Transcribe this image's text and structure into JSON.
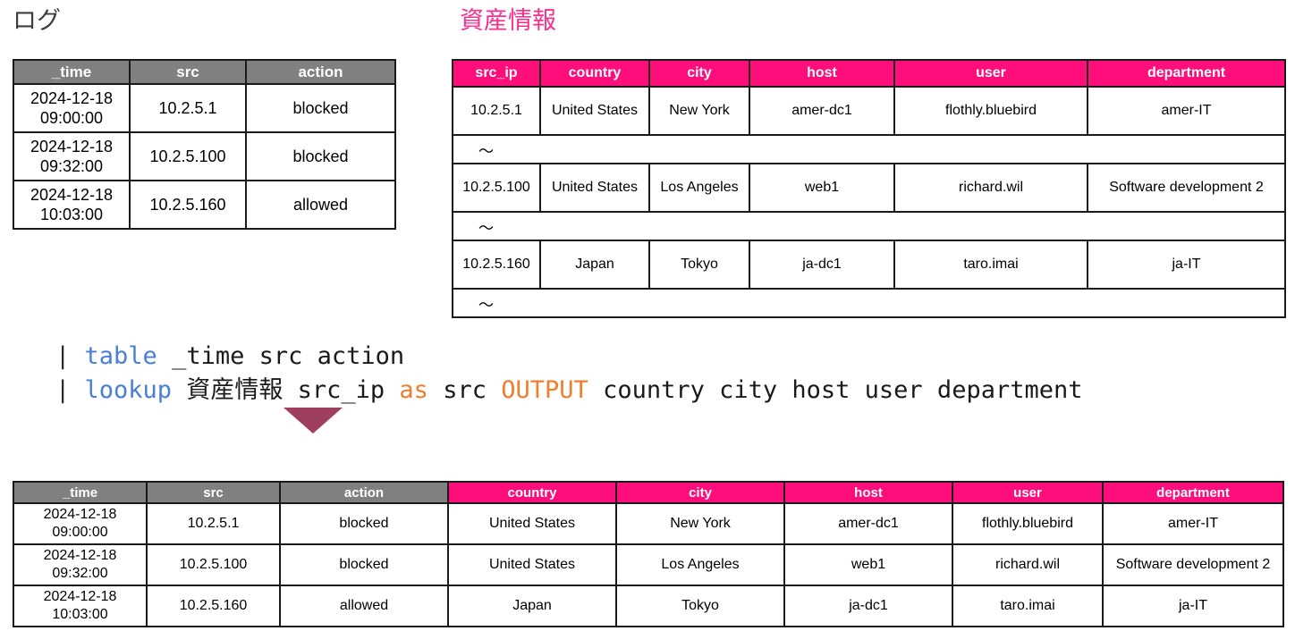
{
  "log_section": {
    "title": "ログ",
    "columns": [
      "_time",
      "src",
      "action"
    ],
    "rows": [
      {
        "time_date": "2024-12-18",
        "time_clock": "09:00:00",
        "src": "10.2.5.1",
        "action": "blocked"
      },
      {
        "time_date": "2024-12-18",
        "time_clock": "09:32:00",
        "src": "10.2.5.100",
        "action": "blocked"
      },
      {
        "time_date": "2024-12-18",
        "time_clock": "10:03:00",
        "src": "10.2.5.160",
        "action": "allowed"
      }
    ]
  },
  "asset_section": {
    "title": "資産情報",
    "columns": [
      "src_ip",
      "country",
      "city",
      "host",
      "user",
      "department"
    ],
    "ellipsis_symbol": "～",
    "rows": [
      {
        "src_ip": "10.2.5.1",
        "country": "United States",
        "city": "New York",
        "host": "amer-dc1",
        "user": "flothly.bluebird",
        "department": "amer-IT"
      },
      {
        "src_ip": "10.2.5.100",
        "country": "United States",
        "city": "Los Angeles",
        "host": "web1",
        "user": "richard.wil",
        "department": "Software development 2"
      },
      {
        "src_ip": "10.2.5.160",
        "country": "Japan",
        "city": "Tokyo",
        "host": "ja-dc1",
        "user": "taro.imai",
        "department": "ja-IT"
      }
    ]
  },
  "query": {
    "line1": {
      "pipe": "|",
      "command": "table",
      "args": "_time src action"
    },
    "line2": {
      "pipe": "|",
      "command": "lookup",
      "lookup_name": "資産情報",
      "match_field": "src_ip",
      "keyword_as": "as",
      "match_target": "src",
      "keyword_output": "OUTPUT",
      "output_fields": "country city host user department"
    },
    "full_text": "| table _time src action\n| lookup 資産情報 src_ip as src OUTPUT country city host user department"
  },
  "flow": {
    "arrow_label": "down-arrow",
    "arrow_color": "#a84060"
  },
  "result_section": {
    "columns": [
      {
        "label": "_time",
        "group": "log"
      },
      {
        "label": "src",
        "group": "log"
      },
      {
        "label": "action",
        "group": "log"
      },
      {
        "label": "country",
        "group": "asset"
      },
      {
        "label": "city",
        "group": "asset"
      },
      {
        "label": "host",
        "group": "asset"
      },
      {
        "label": "user",
        "group": "asset"
      },
      {
        "label": "department",
        "group": "asset"
      }
    ],
    "rows": [
      {
        "time_date": "2024-12-18",
        "time_clock": "09:00:00",
        "src": "10.2.5.1",
        "action": "blocked",
        "country": "United States",
        "city": "New York",
        "host": "amer-dc1",
        "user": "flothly.bluebird",
        "department": "amer-IT"
      },
      {
        "time_date": "2024-12-18",
        "time_clock": "09:32:00",
        "src": "10.2.5.100",
        "action": "blocked",
        "country": "United States",
        "city": "Los Angeles",
        "host": "web1",
        "user": "richard.wil",
        "department": "Software development 2"
      },
      {
        "time_date": "2024-12-18",
        "time_clock": "10:03:00",
        "src": "10.2.5.160",
        "action": "allowed",
        "country": "Japan",
        "city": "Tokyo",
        "host": "ja-dc1",
        "user": "taro.imai",
        "department": "ja-IT"
      }
    ]
  },
  "colors": {
    "header_gray": "#808080",
    "header_pink": "#ff0f7b",
    "title_pink": "#ff2e8b",
    "title_gray": "#3d3d3d",
    "arrow_maroon": "#a84060",
    "token_command": "#4a7fd6",
    "token_keyword": "#f07d2e"
  }
}
